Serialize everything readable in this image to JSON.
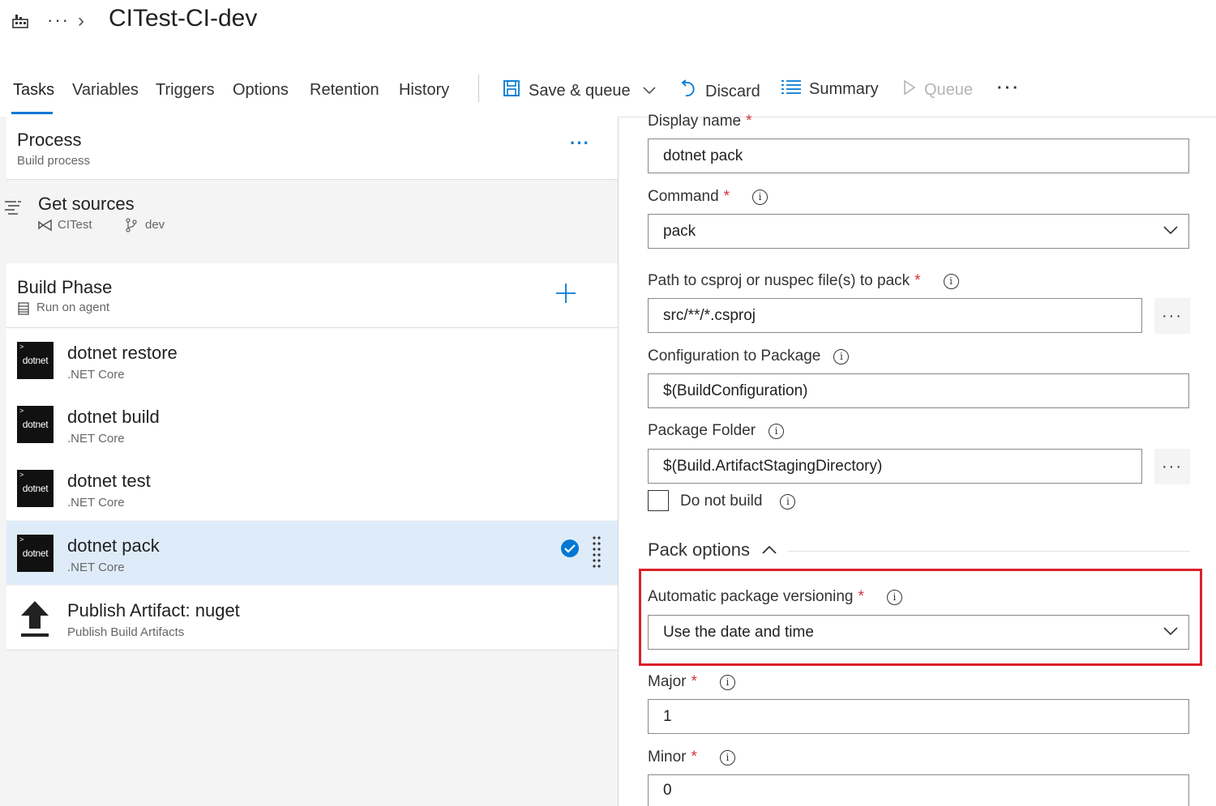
{
  "header": {
    "title": "CITest-CI-dev",
    "more": "···",
    "chevron": "›"
  },
  "tabs": [
    "Tasks",
    "Variables",
    "Triggers",
    "Options",
    "Retention",
    "History"
  ],
  "toolbar": {
    "save_queue": "Save & queue",
    "discard": "Discard",
    "summary": "Summary",
    "queue": "Queue",
    "more": "···"
  },
  "process": {
    "title": "Process",
    "subtitle": "Build process",
    "more": "···"
  },
  "get_sources": {
    "title": "Get sources",
    "repo": "CITest",
    "branch": "dev"
  },
  "phase": {
    "title": "Build Phase",
    "subtitle": "Run on agent"
  },
  "tasks": [
    {
      "title": "dotnet restore",
      "subtitle": ".NET Core",
      "logo": "dotnet"
    },
    {
      "title": "dotnet build",
      "subtitle": ".NET Core",
      "logo": "dotnet"
    },
    {
      "title": "dotnet test",
      "subtitle": ".NET Core",
      "logo": "dotnet"
    },
    {
      "title": "dotnet pack",
      "subtitle": ".NET Core",
      "logo": "dotnet"
    },
    {
      "title": "Publish Artifact: nuget",
      "subtitle": "Publish Build Artifacts"
    }
  ],
  "form": {
    "display_name": {
      "label": "Display name",
      "value": "dotnet pack"
    },
    "command": {
      "label": "Command",
      "value": "pack"
    },
    "path": {
      "label": "Path to csproj or nuspec file(s) to pack",
      "value": "src/**/*.csproj"
    },
    "config": {
      "label": "Configuration to Package",
      "value": "$(BuildConfiguration)"
    },
    "folder": {
      "label": "Package Folder",
      "value": "$(Build.ArtifactStagingDirectory)"
    },
    "do_not_build": {
      "label": "Do not build",
      "checked": false
    },
    "pack_options": {
      "label": "Pack options"
    },
    "versioning": {
      "label": "Automatic package versioning",
      "value": "Use the date and time"
    },
    "major": {
      "label": "Major",
      "value": "1"
    },
    "minor": {
      "label": "Minor",
      "value": "0"
    },
    "required_mark": "*",
    "ellipsis": "···"
  },
  "colors": {
    "accent": "#0078d4",
    "highlight": "#d9222a",
    "selected_row": "#deecf9"
  }
}
